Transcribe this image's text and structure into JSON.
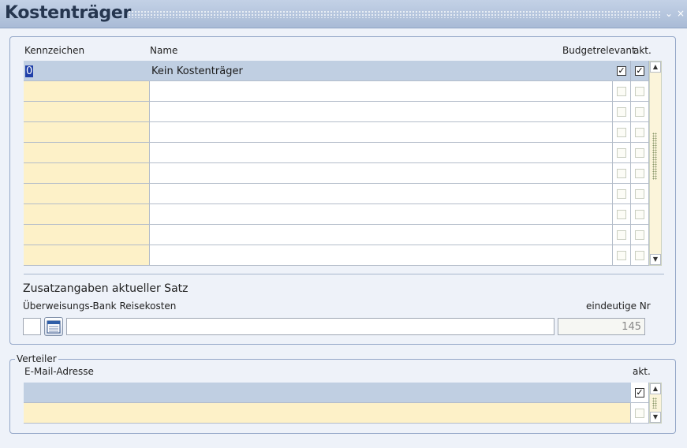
{
  "window": {
    "title": "Kostenträger",
    "minimize_glyph": "⌄",
    "close_glyph": "×"
  },
  "cost_table": {
    "headers": {
      "code": "Kennzeichen",
      "name": "Name",
      "budget": "Budgetrelevant",
      "active": "akt."
    },
    "rows": [
      {
        "code": "0",
        "name": "Kein Kostenträger",
        "budget": true,
        "active": true,
        "selected": true
      },
      {
        "code": "",
        "name": "",
        "budget": false,
        "active": false
      },
      {
        "code": "",
        "name": "",
        "budget": false,
        "active": false
      },
      {
        "code": "",
        "name": "",
        "budget": false,
        "active": false
      },
      {
        "code": "",
        "name": "",
        "budget": false,
        "active": false
      },
      {
        "code": "",
        "name": "",
        "budget": false,
        "active": false
      },
      {
        "code": "",
        "name": "",
        "budget": false,
        "active": false
      },
      {
        "code": "",
        "name": "",
        "budget": false,
        "active": false
      },
      {
        "code": "",
        "name": "",
        "budget": false,
        "active": false
      },
      {
        "code": "",
        "name": "",
        "budget": false,
        "active": false
      }
    ]
  },
  "details": {
    "section_title": "Zusatzangaben aktueller Satz",
    "bank_label": "Überweisungs-Bank Reisekosten",
    "bank_code": "",
    "bank_name": "",
    "unique_label": "eindeutige Nr",
    "unique_value": "145"
  },
  "distribution": {
    "legend": "Verteiler",
    "headers": {
      "email": "E-Mail-Adresse",
      "active": "akt."
    },
    "rows": [
      {
        "email": "",
        "active": true,
        "selected": true
      },
      {
        "email": "",
        "active": false
      }
    ]
  },
  "icons": {
    "minimize": "chevron-down-icon",
    "close": "close-icon",
    "calendar": "calendar-icon",
    "scroll_up": "arrow-up-icon",
    "scroll_down": "arrow-down-icon"
  },
  "colors": {
    "title_bar": "#b5c5de",
    "selected_row": "#c0cfe2",
    "code_column": "#fdf1c8",
    "selection_highlight": "#1f3fa8"
  }
}
